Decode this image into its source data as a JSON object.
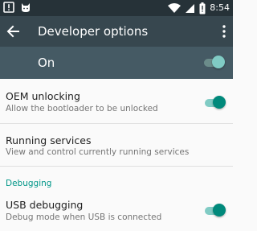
{
  "status_bar": {
    "left_icons": [
      "warning-icon",
      "cat-icon"
    ],
    "right_icons": [
      "wifi-icon",
      "cellular-signal-icon",
      "battery-icon"
    ],
    "time": "8:54"
  },
  "app_bar": {
    "back_icon": "arrow-back-icon",
    "title": "Developer options",
    "menu_icon": "more-vert-icon"
  },
  "master_switch": {
    "label": "On",
    "checked": true
  },
  "preferences": [
    {
      "title": "OEM unlocking",
      "summary": "Allow the bootloader to be unlocked",
      "has_switch": true,
      "checked": true
    },
    {
      "title": "Running services",
      "summary": "View and control currently running services",
      "has_switch": false
    }
  ],
  "category": {
    "title": "Debugging"
  },
  "debugging_preferences": [
    {
      "title": "USB debugging",
      "summary": "Debug mode when USB is connected",
      "has_switch": true,
      "checked": true
    }
  ],
  "colors": {
    "status_bar": "#263238",
    "app_bar": "#37474f",
    "master_bar": "#455a64",
    "accent": "#009688",
    "switch_thumb_on": "#00897b",
    "switch_track_on": "#80cbc4"
  }
}
